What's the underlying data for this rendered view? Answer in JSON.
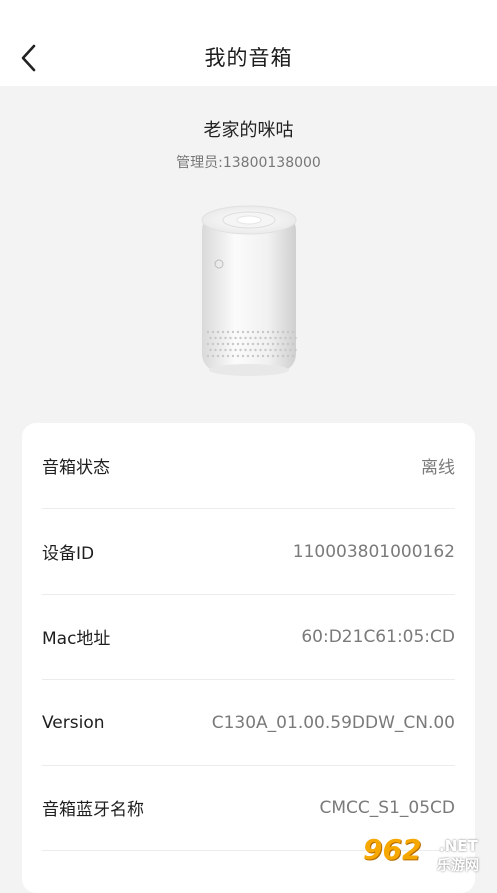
{
  "header": {
    "title": "我的音箱"
  },
  "device": {
    "name": "老家的咪咕",
    "admin": "管理员:13800138000"
  },
  "info_rows": [
    {
      "label": "音箱状态",
      "value": "离线"
    },
    {
      "label": "设备ID",
      "value": "110003801000162"
    },
    {
      "label": "Mac地址",
      "value": "60:D21C61:05:CD"
    },
    {
      "label": "Version",
      "value": "C130A_01.00.59DDW_CN.00"
    },
    {
      "label": "音箱蓝牙名称",
      "value": "CMCC_S1_05CD"
    }
  ],
  "icons": {
    "back": "chevron-left-icon"
  },
  "watermark": {
    "logo": "962",
    "net": ".NET",
    "cn": "乐游网"
  }
}
